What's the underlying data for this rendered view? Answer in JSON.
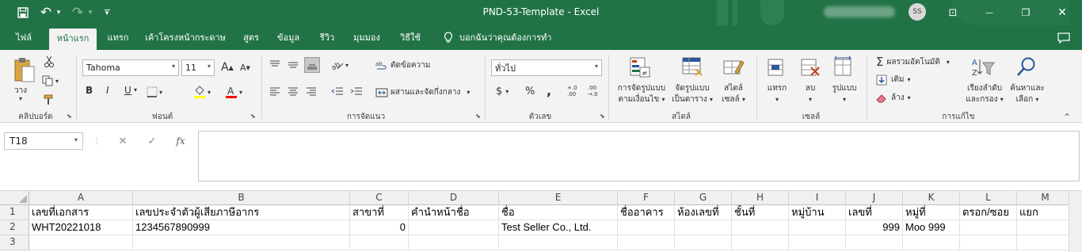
{
  "window": {
    "title": "PND-53-Template  -  Excel",
    "avatar": "SS",
    "minimize": "—",
    "restore": "❐",
    "close": "✕",
    "ribbon_display": "⊡"
  },
  "qat": {
    "save": "save-icon",
    "undo": "↶",
    "undo_dd": "▾",
    "redo": "↷",
    "redo_dd": "▾",
    "customize": "▾"
  },
  "tabs": [
    "ไฟล์",
    "หน้าแรก",
    "แทรก",
    "เค้าโครงหน้ากระดาษ",
    "สูตร",
    "ข้อมูล",
    "รีวิว",
    "มุมมอง",
    "วิธีใช้",
    "บอกฉันว่าคุณต้องการทำอะไร"
  ],
  "lightbulb": "💡",
  "ribbon": {
    "clipboard": {
      "paste": "วาง",
      "group": "คลิปบอร์ด"
    },
    "font": {
      "name": "Tahoma",
      "size": "11",
      "bold": "B",
      "italic": "I",
      "underline": "U",
      "grow": "A",
      "shrink": "A",
      "group": "ฟอนต์",
      "highlight_color": "#ffff00",
      "font_color": "#ff0000"
    },
    "alignment": {
      "wrap": "ตัดข้อความ",
      "merge": "ผสานและจัดกึ่งกลาง",
      "group": "การจัดแนว"
    },
    "number": {
      "format": "ทั่วไป",
      "currency": "$",
      "percent": "%",
      "comma": ",",
      "inc": "+.0\n.00",
      "dec": ".00\n→.0",
      "group": "ตัวเลข"
    },
    "styles": {
      "cond1": "การจัดรูปแบบ",
      "cond2": "ตามเงื่อนไข",
      "table1": "จัดรูปแบบ",
      "table2": "เป็นตาราง",
      "cell1": "สไตล์",
      "cell2": "เซลล์",
      "group": "สไตล์"
    },
    "cells": {
      "insert": "แทรก",
      "delete": "ลบ",
      "format": "รูปแบบ",
      "group": "เซลล์"
    },
    "editing": {
      "autosum": "ผลรวมอัตโนมัติ",
      "fill": "เติม",
      "clear": "ล้าง",
      "sort1": "เรียงลำดับ",
      "sort2": "และกรอง",
      "find1": "ค้นหาและ",
      "find2": "เลือก",
      "group": "การแก้ไข"
    }
  },
  "formula": {
    "namebox": "T18",
    "cancel": "✕",
    "enter": "✓",
    "fx": "fx",
    "value": ""
  },
  "columns": [
    "A",
    "B",
    "C",
    "D",
    "E",
    "F",
    "G",
    "H",
    "I",
    "J",
    "K",
    "L",
    "M"
  ],
  "rows": [
    {
      "num": "1",
      "cells": [
        "เลขที่เอกสาร",
        "เลขประจำตัวผู้เสียภาษีอากร",
        "สาขาที่",
        "คำนำหน้าชื่อ",
        "ชื่อ",
        "ชื่ออาคาร",
        "ห้องเลขที่",
        "ชั้นที่",
        "หมู่บ้าน",
        "เลขที่",
        "หมู่ที่",
        "ตรอก/ซอย",
        "แยก"
      ]
    },
    {
      "num": "2",
      "cells": [
        "WHT20221018",
        "1234567890999",
        "0",
        "",
        "Test Seller Co., Ltd.",
        "",
        "",
        "",
        "",
        "999",
        "Moo 999",
        "",
        ""
      ]
    },
    {
      "num": "3",
      "cells": [
        "",
        "",
        "",
        "",
        "",
        "",
        "",
        "",
        "",
        "",
        "",
        "",
        ""
      ]
    }
  ]
}
